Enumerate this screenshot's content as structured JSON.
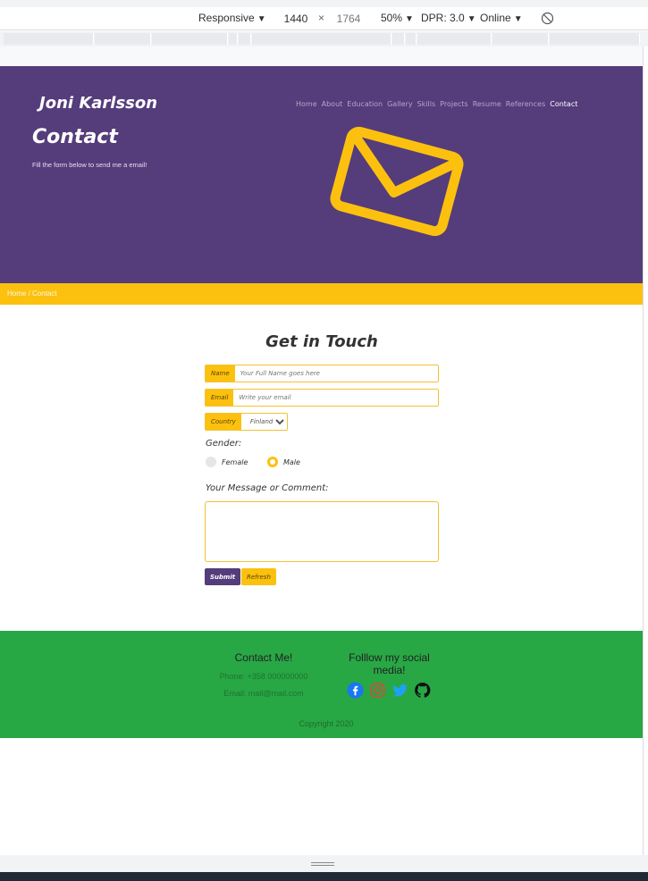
{
  "devtools": {
    "device": "Responsive",
    "width": "1440",
    "times": "×",
    "height": "1764",
    "zoom": "50%",
    "dpr": "DPR: 3.0",
    "network": "Online",
    "arrow": "▼"
  },
  "site": {
    "brand": "Joni Karlsson",
    "nav": [
      "Home",
      "About",
      "Education",
      "Gallery",
      "Skills",
      "Projects",
      "Resume",
      "References",
      "Contact"
    ],
    "hero_title": "Contact",
    "hero_subtitle": "Fill the form below to send me a email!",
    "breadcrumb": {
      "home": "Home",
      "sep": " / ",
      "current": "Contact"
    }
  },
  "form": {
    "title": "Get in Touch",
    "name_label": "Name",
    "name_placeholder": "Your Full Name goes here",
    "email_label": "Email",
    "email_placeholder": "Write your email",
    "country_label": "Country",
    "country_value": "Finland",
    "gender_label": "Gender:",
    "gender_options": [
      "Female",
      "Male"
    ],
    "gender_selected": "Male",
    "message_label": "Your Message or Comment:",
    "submit": "Submit",
    "refresh": "Refresh"
  },
  "footer": {
    "contact_heading": "Contact Me!",
    "phone": "Phone: +358 000000000",
    "email": "Email: mail@mail.com",
    "social_heading": "Folllow my social media!",
    "socials": [
      "facebook-icon",
      "instagram-icon",
      "twitter-icon",
      "github-icon"
    ],
    "copyright": "Copyright 2020"
  },
  "colors": {
    "hero": "#553c7b",
    "accent": "#fcc10f",
    "footer": "#28a745"
  }
}
